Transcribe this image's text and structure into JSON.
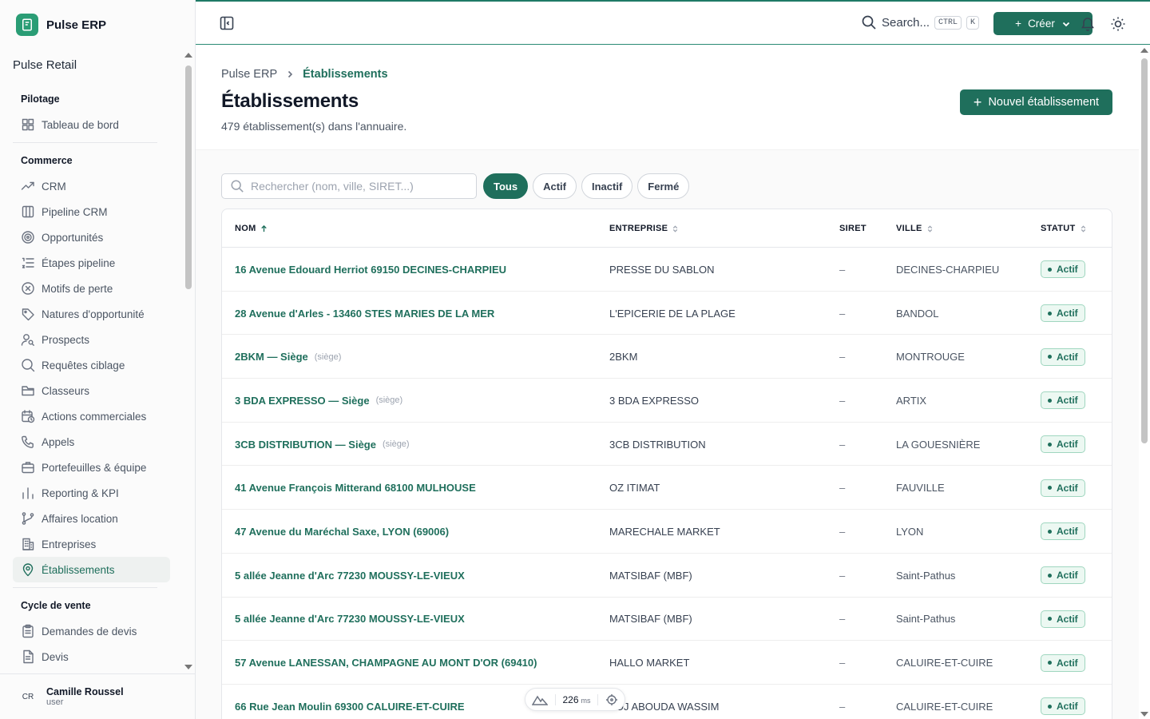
{
  "app": {
    "name": "Pulse ERP",
    "org": "Pulse Retail",
    "brand_color": "#2a9d75",
    "accent": "#1f6f5c"
  },
  "sidebar": {
    "sections": [
      {
        "title": "Pilotage",
        "items": [
          {
            "label": "Tableau de bord",
            "icon": "dashboard-icon"
          }
        ]
      },
      {
        "title": "Commerce",
        "items": [
          {
            "label": "CRM",
            "icon": "trending-up-icon"
          },
          {
            "label": "Pipeline CRM",
            "icon": "columns-icon"
          },
          {
            "label": "Opportunités",
            "icon": "target-icon"
          },
          {
            "label": "Étapes pipeline",
            "icon": "list-ordered-icon"
          },
          {
            "label": "Motifs de perte",
            "icon": "x-circle-icon"
          },
          {
            "label": "Natures d'opportunité",
            "icon": "tag-icon"
          },
          {
            "label": "Prospects",
            "icon": "user-search-icon"
          },
          {
            "label": "Requêtes ciblage",
            "icon": "search-icon"
          },
          {
            "label": "Classeurs",
            "icon": "folder-icon"
          },
          {
            "label": "Actions commerciales",
            "icon": "calendar-clock-icon"
          },
          {
            "label": "Appels",
            "icon": "phone-icon"
          },
          {
            "label": "Portefeuilles & équipe",
            "icon": "briefcase-icon"
          },
          {
            "label": "Reporting & KPI",
            "icon": "bar-chart-icon"
          },
          {
            "label": "Affaires location",
            "icon": "git-branch-icon"
          },
          {
            "label": "Entreprises",
            "icon": "building-icon"
          },
          {
            "label": "Établissements",
            "icon": "map-pin-icon",
            "active": true
          }
        ]
      },
      {
        "title": "Cycle de vente",
        "items": [
          {
            "label": "Demandes de devis",
            "icon": "clipboard-list-icon"
          },
          {
            "label": "Devis",
            "icon": "file-text-icon"
          }
        ]
      }
    ],
    "user": {
      "initials": "CR",
      "name": "Camille Roussel",
      "role": "user"
    }
  },
  "topbar": {
    "search_label": "Search...",
    "kbd_ctrl": "CTRL",
    "kbd_k": "K",
    "create_label": "Créer"
  },
  "page": {
    "breadcrumb": [
      "Pulse ERP",
      "Établissements"
    ],
    "title": "Établissements",
    "subtitle": "479 établissement(s) dans l'annuaire.",
    "new_button": "Nouvel établissement"
  },
  "filters": {
    "search_placeholder": "Rechercher (nom, ville, SIRET...)",
    "chips": [
      "Tous",
      "Actif",
      "Inactif",
      "Fermé"
    ],
    "active_chip": "Tous"
  },
  "table": {
    "columns": [
      "NOM",
      "ENTREPRISE",
      "SIRET",
      "VILLE",
      "STATUT"
    ],
    "rows": [
      {
        "nom": "16 Avenue Edouard Herriot 69150 DECINES-CHARPIEU",
        "hq": "",
        "entreprise": "PRESSE DU SABLON",
        "siret": "–",
        "ville": "DECINES-CHARPIEU",
        "statut": "Actif"
      },
      {
        "nom": "28 Avenue d'Arles - 13460 STES MARIES DE LA MER",
        "hq": "",
        "entreprise": "L'EPICERIE DE LA PLAGE",
        "siret": "–",
        "ville": "BANDOL",
        "statut": "Actif"
      },
      {
        "nom": "2BKM — Siège",
        "hq": "(siège)",
        "entreprise": "2BKM",
        "siret": "–",
        "ville": "MONTROUGE",
        "statut": "Actif"
      },
      {
        "nom": "3 BDA EXPRESSO — Siège",
        "hq": "(siège)",
        "entreprise": "3 BDA EXPRESSO",
        "siret": "–",
        "ville": "ARTIX",
        "statut": "Actif"
      },
      {
        "nom": "3CB DISTRIBUTION — Siège",
        "hq": "(siège)",
        "entreprise": "3CB DISTRIBUTION",
        "siret": "–",
        "ville": "LA GOUESNIÈRE",
        "statut": "Actif"
      },
      {
        "nom": "41 Avenue François Mitterand 68100 MULHOUSE",
        "hq": "",
        "entreprise": "OZ ITIMAT",
        "siret": "–",
        "ville": "FAUVILLE",
        "statut": "Actif"
      },
      {
        "nom": "47 Avenue du Maréchal Saxe, LYON (69006)",
        "hq": "",
        "entreprise": "MARECHALE MARKET",
        "siret": "–",
        "ville": "LYON",
        "statut": "Actif"
      },
      {
        "nom": "5 allée Jeanne d'Arc 77230 MOUSSY-LE-VIEUX",
        "hq": "",
        "entreprise": "MATSIBAF (MBF)",
        "siret": "–",
        "ville": "Saint-Pathus",
        "statut": "Actif"
      },
      {
        "nom": "5 allée Jeanne d'Arc 77230 MOUSSY-LE-VIEUX",
        "hq": "",
        "entreprise": "MATSIBAF (MBF)",
        "siret": "–",
        "ville": "Saint-Pathus",
        "statut": "Actif"
      },
      {
        "nom": "57 Avenue LANESSAN, CHAMPAGNE AU MONT D'OR (69410)",
        "hq": "",
        "entreprise": "HALLO MARKET",
        "siret": "–",
        "ville": "CALUIRE-ET-CUIRE",
        "statut": "Actif"
      },
      {
        "nom": "66 Rue Jean Moulin 69300 CALUIRE-ET-CUIRE",
        "hq": "",
        "entreprise": "ADJ ABOUDA WASSIM",
        "siret": "–",
        "ville": "CALUIRE-ET-CUIRE",
        "statut": "Actif"
      }
    ]
  },
  "perf_widget": {
    "value": "226",
    "unit": "ms"
  }
}
